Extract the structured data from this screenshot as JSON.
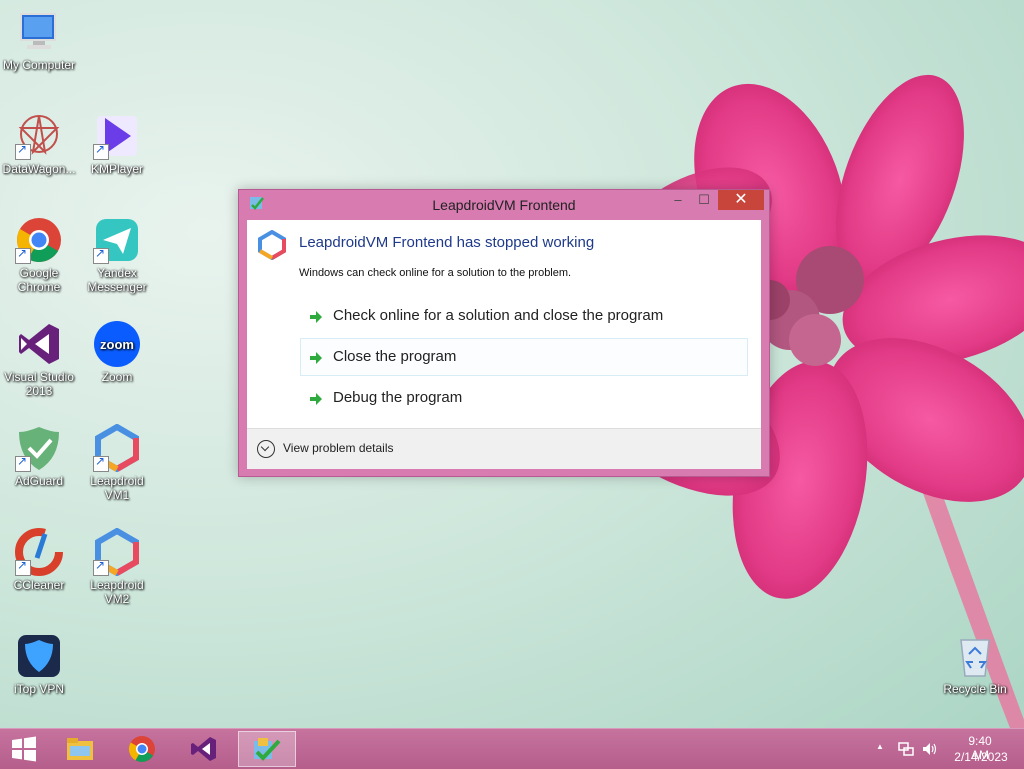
{
  "desktop": {
    "icons": [
      {
        "label": "My Computer"
      },
      {
        "label": "DataWagon..."
      },
      {
        "label": "KMPlayer"
      },
      {
        "label": "Google Chrome"
      },
      {
        "label": "Yandex Messenger"
      },
      {
        "label": "Visual Studio 2013"
      },
      {
        "label": "Zoom"
      },
      {
        "label": "AdGuard"
      },
      {
        "label": "Leapdroid VM1"
      },
      {
        "label": "CCleaner"
      },
      {
        "label": "Leapdroid VM2"
      },
      {
        "label": "iTop VPN"
      },
      {
        "label": "Recycle Bin"
      }
    ],
    "zoom_icon_text": "zoom"
  },
  "dialog": {
    "title": "LeapdroidVM Frontend",
    "heading": "LeapdroidVM Frontend has stopped working",
    "subtext": "Windows can check online for a solution to the problem.",
    "options": [
      {
        "label": "Check online for a solution and close the program"
      },
      {
        "label": "Close the program"
      },
      {
        "label": "Debug the program"
      }
    ],
    "details_label": "View problem details",
    "minimize_glyph": "–",
    "maximize_glyph": "☐",
    "close_glyph": "✕"
  },
  "taskbar": {
    "items": [
      "start-icon",
      "file-explorer-icon",
      "chrome-icon",
      "visual-studio-icon",
      "leapdroid-frontend-icon"
    ],
    "tray": {
      "up_arrow": "▲",
      "time": "9:40 AM",
      "date": "2/14/2023"
    }
  },
  "colors": {
    "dialog_frame": "#d77bb1",
    "taskbar": "#b55e8c",
    "close_button": "#c7453b",
    "heading_text": "#1f3a8a",
    "arrow_green": "#2eaa3e"
  }
}
